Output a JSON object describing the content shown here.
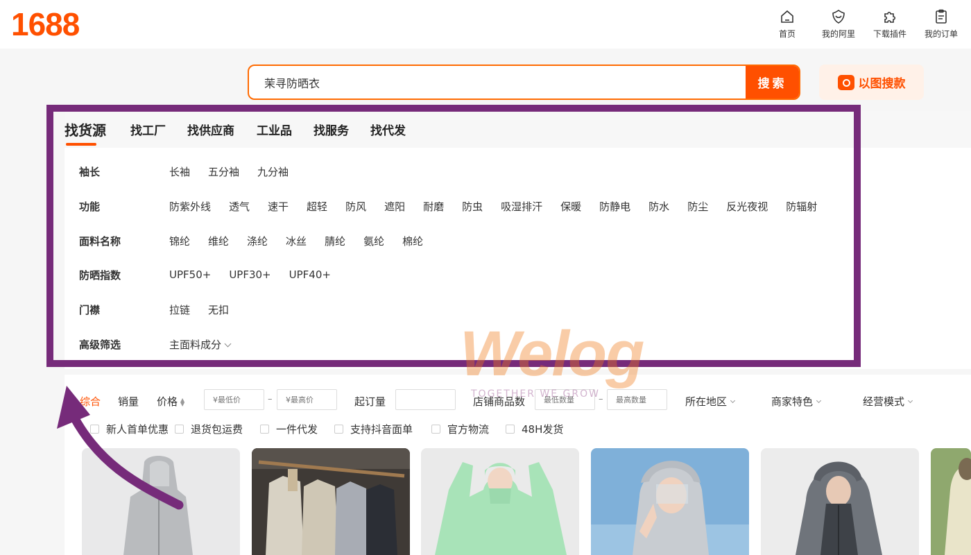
{
  "logo": "1688",
  "topnav": [
    {
      "label": "首页",
      "icon": "home-icon"
    },
    {
      "label": "我的阿里",
      "icon": "shield-icon"
    },
    {
      "label": "下载插件",
      "icon": "puzzle-icon"
    },
    {
      "label": "我的订单",
      "icon": "clipboard-icon"
    }
  ],
  "search": {
    "value": "茉寻防晒衣",
    "button": "搜索",
    "image_search": "以图搜款"
  },
  "tabs": [
    "找货源",
    "找工厂",
    "找供应商",
    "工业品",
    "找服务",
    "找代发"
  ],
  "filters": [
    {
      "label": "袖长",
      "options": [
        "长袖",
        "五分袖",
        "九分袖"
      ]
    },
    {
      "label": "功能",
      "options": [
        "防紫外线",
        "透气",
        "速干",
        "超轻",
        "防风",
        "遮阳",
        "耐磨",
        "防虫",
        "吸湿排汗",
        "保暖",
        "防静电",
        "防水",
        "防尘",
        "反光夜视",
        "防辐射"
      ]
    },
    {
      "label": "面料名称",
      "options": [
        "锦纶",
        "维纶",
        "涤纶",
        "冰丝",
        "腈纶",
        "氨纶",
        "棉纶"
      ]
    },
    {
      "label": "防晒指数",
      "options": [
        "UPF50+",
        "UPF30+",
        "UPF40+"
      ]
    },
    {
      "label": "门襟",
      "options": [
        "拉链",
        "无扣"
      ]
    },
    {
      "label": "高级筛选",
      "options": [
        "主面料成分"
      ]
    }
  ],
  "sort": {
    "overall": "综合",
    "sales": "销量",
    "price": "价格",
    "price_min": "¥最低价",
    "price_max": "¥最高价",
    "moq": "起订量",
    "store_count": "店铺商品数",
    "min_qty": "最低数量",
    "max_qty": "最高数量",
    "region": "所在地区",
    "merchant": "商家特色",
    "mode": "经营模式"
  },
  "checkboxes": [
    "新人首单优惠",
    "退货包运费",
    "一件代发",
    "支持抖音面单",
    "官方物流",
    "48H发货"
  ],
  "watermark": {
    "brand": "Welog",
    "tagline": "TOGETHER WE GROW"
  },
  "colors": {
    "accent": "#ff5000",
    "frame": "#762b7a"
  }
}
